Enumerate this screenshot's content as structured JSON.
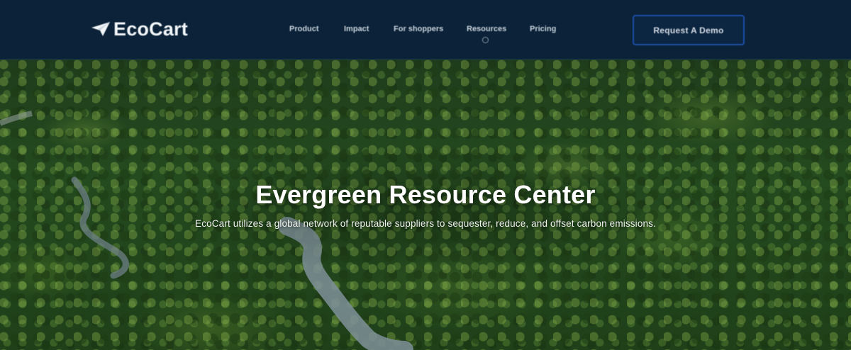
{
  "nav": {
    "logo_text": "EcoCart",
    "items": [
      {
        "label": "Product"
      },
      {
        "label": "Impact"
      },
      {
        "label": "For shoppers"
      },
      {
        "label": "Resources",
        "active": true
      },
      {
        "label": "Pricing"
      }
    ],
    "cta_label": "Request A Demo"
  },
  "hero": {
    "title": "Evergreen Resource Center",
    "subtitle": "EcoCart utilizes a global network of reputable suppliers to sequester, reduce, and offset carbon emissions."
  },
  "colors": {
    "nav_bg": "#0b2238",
    "cta_border": "#1c4fa8",
    "forest": "#244a1f"
  },
  "icons": {
    "logo": "paper-plane-icon",
    "active_indicator": "circle-indicator-icon"
  }
}
